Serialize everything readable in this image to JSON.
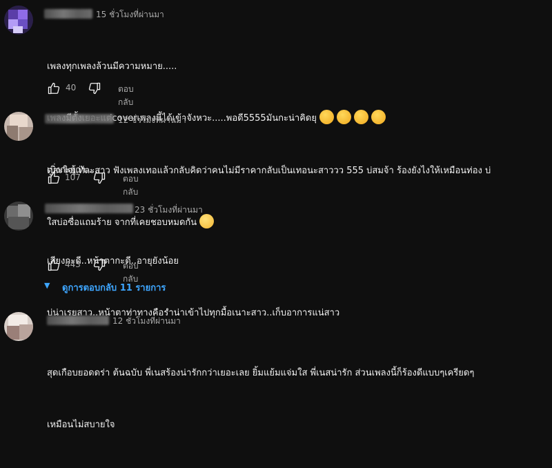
{
  "comments": [
    {
      "time": "15 ชั่วโมงที่ผ่านมา",
      "text_lines": [
        "เพลงทุกเพลงล้วนมีความหมาย.....",
        "เพลงมีตั้งเยอะแต่coverเพลงนี้ได้เข้าจังหวะ.....พอดี5555มันกะน่าคิดยุ",
        "เบิ่งกะฮู้ว่า....."
      ],
      "emoji": [
        "rolling-on-floor-laughing",
        "rolling-on-floor-laughing",
        "rolling-on-floor-laughing",
        "rolling-on-floor-laughing"
      ],
      "likes": "40",
      "reply_label": "ตอบกลับ"
    },
    {
      "time": "12 ชั่วโมงที่ผ่านมา",
      "text_lines": [
        "ดูสะใจแท้ละสาว ฟังเพลงเทอแล้วกลับคิดว่าคนไม่มีราคากลับเป็นเทอนะสาววว 555 บ่สมจ้า ร้องยังไงให้เหมือนท่อง บ่",
        "ใสบ่อซื่อแถมร้าย จากที่เคยชอบหมดกัน"
      ],
      "emoji": [
        "face-with-rolling-eyes"
      ],
      "likes": "107",
      "reply_label": "ตอบกลับ"
    },
    {
      "time": "23 ชั่วโมงที่ผ่านมา",
      "text_lines": [
        "เสียงกะดี..หน้าตากะดี..อายุยังน้อย",
        "บ่น่าเรยสาว..หน้าตาท่าทางคือรำน่าเข้าไปทุกมื้อเนาะสาว..เก็บอาการแน่สาว"
      ],
      "likes": "443",
      "reply_label": "ตอบกลับ",
      "replies_toggle": "ดูการตอบกลับ 11 รายการ"
    },
    {
      "time": "12 ชั่วโมงที่ผ่านมา",
      "text_lines": [
        "สุดเกือบยอดดร่า ต้นฉบับ พี่เนสร้องน่ารักกว่าเยอะเลย ยิ้มแย้มแจ่มใส พี่เนสน่ารัก ส่วนเพลงนี้ก็ร้องดีแบบๆเครียดๆ",
        "เหมือนไม่สบายใจ"
      ]
    }
  ],
  "icons": {
    "like": "thumb-up-icon",
    "dislike": "thumb-down-icon",
    "expand": "caret-down-icon"
  },
  "colors": {
    "background": "#0f0f0f",
    "text": "#f1f1f1",
    "muted": "#aaaaaa",
    "link": "#3ea6ff"
  }
}
